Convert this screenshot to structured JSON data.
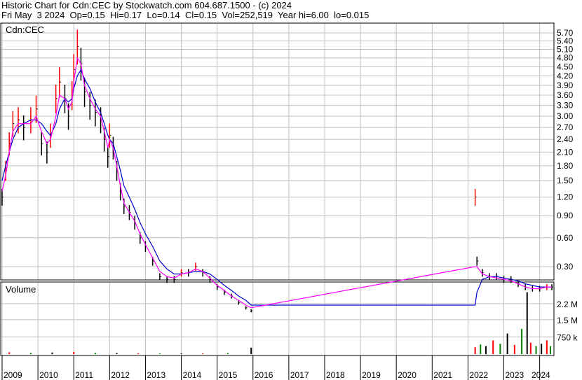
{
  "header": {
    "line1": "Historic Chart for Cdn:CEC by Stockwatch.com 604.687.1500 - (c) 2024",
    "line2": "Fri May  3 2024  Op=0.15  Hi=0.17  Lo=0.14  Cl=0.15  Vol=252,519  Year hi=6.00  lo=0.015"
  },
  "chart_data": [
    {
      "type": "line",
      "panel": "price",
      "title": "Cdn:CEC",
      "yticks": [
        "5.70",
        "5.40",
        "5.10",
        "4.80",
        "4.50",
        "4.20",
        "3.90",
        "3.60",
        "3.30",
        "3.00",
        "2.70",
        "2.40",
        "2.10",
        "1.80",
        "1.50",
        "1.20",
        "0.90",
        "0.60",
        "0.30"
      ],
      "yscale": "sqrt",
      "xticks": [
        "2009",
        "2010",
        "2011",
        "2012",
        "2013",
        "2014",
        "2015",
        "2016",
        "2017",
        "2018",
        "2019",
        "2020",
        "2021",
        "2022",
        "2023",
        "2024"
      ],
      "grid": true,
      "colors": {
        "bars": "#000000",
        "up": "#ff0000",
        "ma_short": "#ff00ff",
        "ma_long": "#0000cc",
        "grid": "#c0c0c0"
      },
      "x": [
        2009.0,
        2009.1,
        2009.2,
        2009.3,
        2009.45,
        2009.6,
        2009.8,
        2009.95,
        2010.1,
        2010.25,
        2010.35,
        2010.5,
        2010.6,
        2010.75,
        2010.85,
        2010.95,
        2011.0,
        2011.1,
        2011.2,
        2011.3,
        2011.45,
        2011.6,
        2011.75,
        2011.85,
        2011.95,
        2012.0,
        2012.1,
        2012.2,
        2012.3,
        2012.4,
        2012.55,
        2012.7,
        2012.85,
        2013.0,
        2013.2,
        2013.4,
        2013.6,
        2013.8,
        2014.0,
        2014.2,
        2014.4,
        2014.6,
        2014.8,
        2015.0,
        2015.2,
        2015.4,
        2015.6,
        2015.8,
        2015.95,
        2022.2,
        2022.25,
        2022.4,
        2022.6,
        2022.8,
        2023.0,
        2023.2,
        2023.4,
        2023.6,
        2023.8,
        2024.0,
        2024.2,
        2024.34
      ],
      "close": [
        1.2,
        1.7,
        2.3,
        2.8,
        2.9,
        2.7,
        2.9,
        3.2,
        2.3,
        2.1,
        2.5,
        3.5,
        4.0,
        3.5,
        3.0,
        3.6,
        4.4,
        5.2,
        4.6,
        3.7,
        3.3,
        3.1,
        2.9,
        2.4,
        2.0,
        2.5,
        2.2,
        1.7,
        1.3,
        1.05,
        0.95,
        0.8,
        0.6,
        0.5,
        0.35,
        0.22,
        0.2,
        0.2,
        0.25,
        0.25,
        0.3,
        0.25,
        0.2,
        0.15,
        0.12,
        0.1,
        0.07,
        0.05,
        0.04,
        1.2,
        0.35,
        0.25,
        0.22,
        0.22,
        0.2,
        0.2,
        0.17,
        0.15,
        0.14,
        0.14,
        0.15,
        0.15
      ],
      "ma_short": [
        1.3,
        1.6,
        2.1,
        2.6,
        2.8,
        2.8,
        2.8,
        3.0,
        2.6,
        2.3,
        2.4,
        3.0,
        3.6,
        3.5,
        3.2,
        3.4,
        4.0,
        4.8,
        4.6,
        3.9,
        3.5,
        3.2,
        3.0,
        2.6,
        2.2,
        2.4,
        2.2,
        1.8,
        1.4,
        1.1,
        0.95,
        0.82,
        0.65,
        0.52,
        0.38,
        0.26,
        0.22,
        0.21,
        0.24,
        0.25,
        0.28,
        0.26,
        0.21,
        0.16,
        0.13,
        0.1,
        0.08,
        0.06,
        0.05,
        0.3,
        0.3,
        0.24,
        0.22,
        0.21,
        0.2,
        0.19,
        0.17,
        0.15,
        0.14,
        0.14,
        0.15,
        0.15
      ],
      "ma_long": [
        1.5,
        1.8,
        2.1,
        2.4,
        2.7,
        2.8,
        2.9,
        2.9,
        2.8,
        2.6,
        2.5,
        2.8,
        3.2,
        3.5,
        3.4,
        3.5,
        3.8,
        4.2,
        4.4,
        4.1,
        3.8,
        3.4,
        3.1,
        2.8,
        2.5,
        2.4,
        2.3,
        2.0,
        1.7,
        1.4,
        1.2,
        1.0,
        0.8,
        0.65,
        0.5,
        0.35,
        0.28,
        0.24,
        0.24,
        0.25,
        0.26,
        0.26,
        0.24,
        0.2,
        0.16,
        0.13,
        0.1,
        0.08,
        0.06,
        0.06,
        0.12,
        0.2,
        0.22,
        0.22,
        0.21,
        0.2,
        0.19,
        0.17,
        0.16,
        0.15,
        0.15,
        0.15
      ]
    },
    {
      "type": "bar",
      "panel": "volume",
      "title": "Volume",
      "yticks": [
        "2.2 M",
        "1.5 M",
        "750 k"
      ],
      "x": [
        2009.2,
        2009.8,
        2010.4,
        2011.0,
        2011.6,
        2012.2,
        2012.8,
        2013.4,
        2014.0,
        2014.6,
        2015.3,
        2015.95,
        2022.2,
        2022.35,
        2022.5,
        2022.7,
        2022.9,
        2023.1,
        2023.3,
        2023.5,
        2023.65,
        2023.75,
        2023.9,
        2024.05,
        2024.2,
        2024.3
      ],
      "volume": [
        80000,
        60000,
        70000,
        90000,
        60000,
        50000,
        40000,
        30000,
        30000,
        30000,
        50000,
        280000,
        300000,
        420000,
        350000,
        600000,
        450000,
        900000,
        400000,
        1100000,
        2700000,
        500000,
        350000,
        450000,
        600000,
        350000
      ]
    }
  ]
}
